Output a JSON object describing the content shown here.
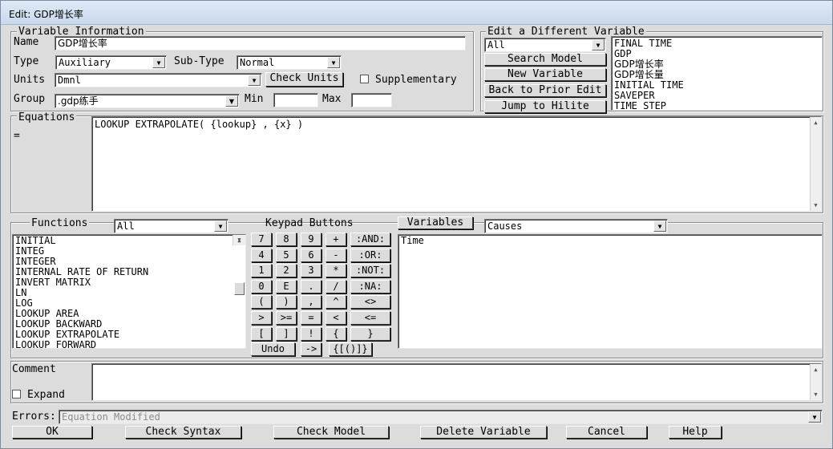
{
  "window": {
    "title": "Edit: GDP增长率"
  },
  "variable_info": {
    "section_label": "Variable Information",
    "name_label": "Name",
    "name_value": "GDP增长率",
    "type_label": "Type",
    "type_value": "Auxiliary",
    "subtype_label": "Sub-Type",
    "subtype_value": "Normal",
    "units_label": "Units",
    "units_value": "Dmnl",
    "check_units_label": "Check Units",
    "supplementary_label": "Supplementary",
    "group_label": "Group",
    "group_value": ".gdp练手",
    "min_label": "Min",
    "max_label": "Max"
  },
  "edit_different": {
    "section_label": "Edit a Different Variable",
    "filter_value": "All",
    "search_model_label": "Search Model",
    "new_variable_label": "New Variable",
    "back_label": "Back to Prior Edit",
    "jump_label": "Jump to Hilite",
    "variables": [
      "FINAL TIME",
      "GDP",
      "GDP增长率",
      "GDP增长量",
      "INITIAL TIME",
      "SAVEPER",
      "TIME STEP"
    ]
  },
  "equations": {
    "label": "Equations",
    "equals": "=",
    "text": "LOOKUP EXTRAPOLATE( {lookup} , {x} )"
  },
  "functions": {
    "label": "Functions",
    "filter_value": "All",
    "items": [
      "INITIAL",
      "INTEG",
      "INTEGER",
      "INTERNAL RATE OF RETURN",
      "INVERT MATRIX",
      "LN",
      "LOG",
      "LOOKUP AREA",
      "LOOKUP BACKWARD",
      "LOOKUP EXTRAPOLATE",
      "LOOKUP FORWARD"
    ]
  },
  "keypad": {
    "label": "Keypad Buttons",
    "rows": [
      [
        "7",
        "8",
        "9",
        "+",
        ":AND:"
      ],
      [
        "4",
        "5",
        "6",
        "-",
        ":OR:"
      ],
      [
        "1",
        "2",
        "3",
        "*",
        ":NOT:"
      ],
      [
        "0",
        "E",
        ".",
        "/",
        ":NA:"
      ],
      [
        "(",
        ")",
        ",",
        "^",
        "<>"
      ],
      [
        ">",
        ">=",
        "=",
        "<",
        "<="
      ],
      [
        "[",
        "]",
        "!",
        "{",
        "}"
      ]
    ],
    "undo_label": "Undo",
    "arrow_label": "->",
    "brackets_label": "{[()]}"
  },
  "variables_panel": {
    "button_label": "Variables",
    "filter_value": "Causes",
    "items": [
      "Time"
    ]
  },
  "comment": {
    "label": "Comment",
    "expand_label": "Expand"
  },
  "errors": {
    "label": "Errors:",
    "value": "Equation Modified"
  },
  "footer": {
    "ok_label": "OK",
    "check_syntax_label": "Check Syntax",
    "check_model_label": "Check Model",
    "delete_variable_label": "Delete Variable",
    "cancel_label": "Cancel",
    "help_label": "Help"
  }
}
